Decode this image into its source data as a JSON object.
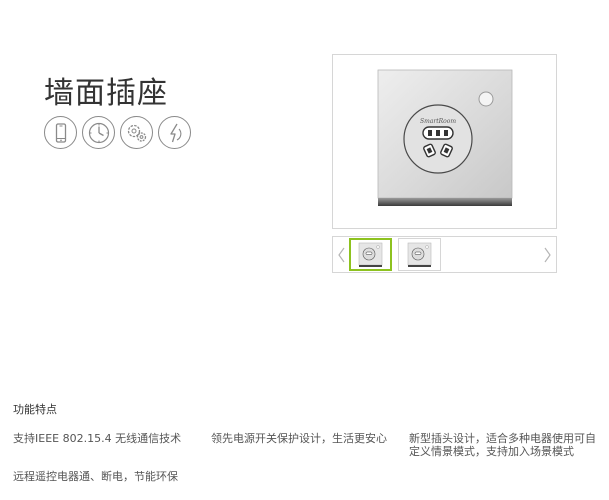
{
  "product": {
    "title": "墙面插座"
  },
  "feature_icons": [
    "phone-icon",
    "clock-icon",
    "gears-icon",
    "energy-saving-icon"
  ],
  "gallery": {
    "socket_brand": "SmartRoom",
    "active_thumb": 1,
    "thumb_count": 2
  },
  "features": {
    "heading": "功能特点",
    "items": [
      "支持IEEE 802.15.4 无线通信技术",
      "领先电源开关保护设计，生活更安心",
      "新型插头设计，适合多种电器使用可自定义情景模式，支持加入场景模式",
      "远程遥控电器通、断电，节能环保"
    ]
  },
  "colors": {
    "accent_green": "#8dc21f",
    "border_gray": "#d6d6d6",
    "icon_gray": "#8a8a8a"
  }
}
